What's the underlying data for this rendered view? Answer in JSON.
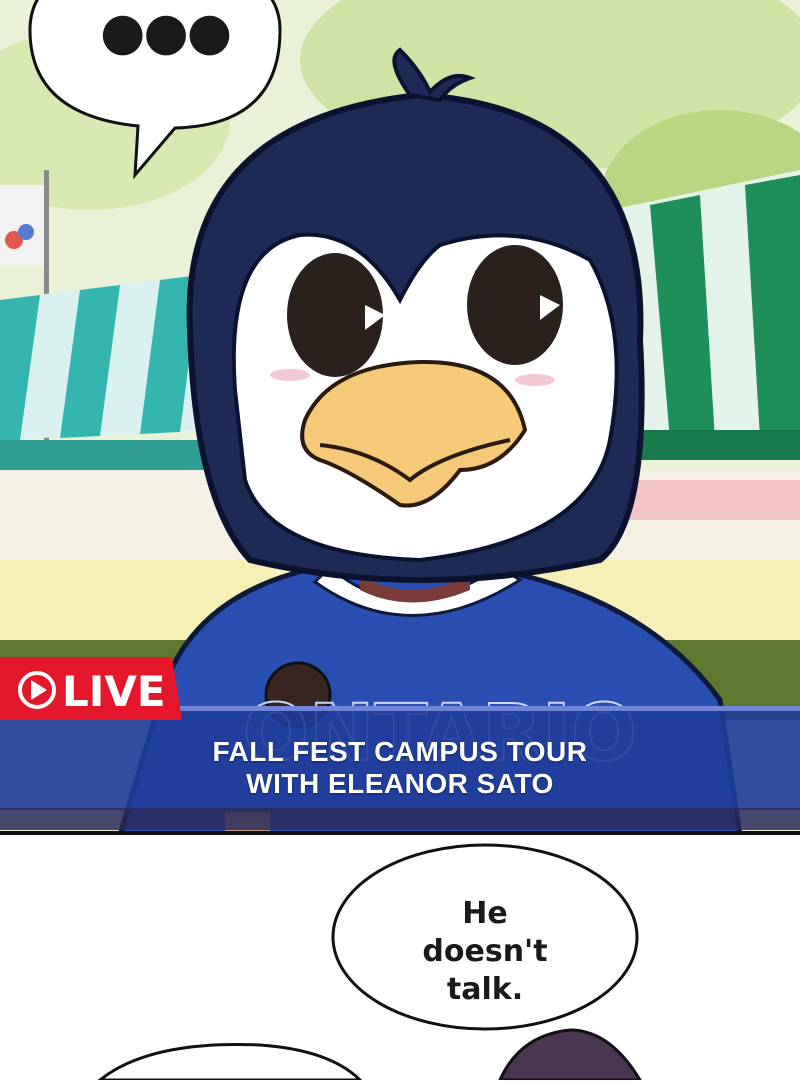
{
  "speech": {
    "top_bubble": "●●●",
    "bottom_bubble_line1": "He",
    "bottom_bubble_line2": "doesn't",
    "bottom_bubble_line3": "talk."
  },
  "broadcast": {
    "live_label": "LIVE",
    "title_line1": "FALL FEST CAMPUS TOUR",
    "title_line2": "WITH ELEANOR SATO"
  },
  "shirt_text": "ONTARIO",
  "colors": {
    "live_red": "#e5172b",
    "banner_blue": "#1f3c98",
    "mascot_navy": "#1e2b57",
    "shirt_blue": "#2a4fb3",
    "beak": "#f6c978"
  }
}
